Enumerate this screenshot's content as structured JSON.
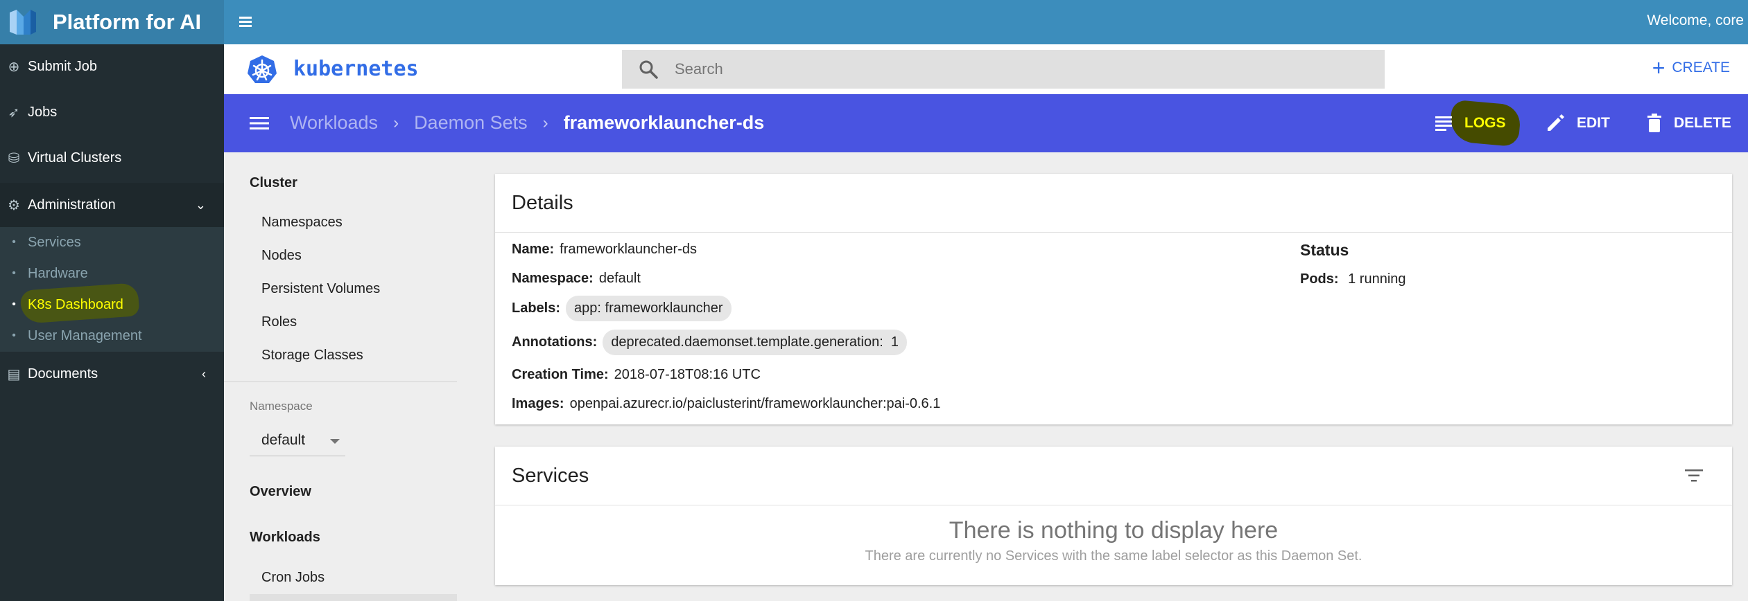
{
  "pai": {
    "brand": "Platform for AI",
    "welcome": "Welcome, core",
    "sidebar": {
      "items": [
        {
          "label": "Submit Job",
          "icon": "plus-circle-icon"
        },
        {
          "label": "Jobs",
          "icon": "rocket-icon"
        },
        {
          "label": "Virtual Clusters",
          "icon": "cubes-icon"
        },
        {
          "label": "Administration",
          "icon": "gears-icon"
        },
        {
          "label": "Documents",
          "icon": "book-icon"
        }
      ],
      "admin_sub": [
        {
          "label": "Services"
        },
        {
          "label": "Hardware"
        },
        {
          "label": "K8s Dashboard"
        },
        {
          "label": "User Management"
        }
      ]
    }
  },
  "k8s": {
    "wordmark": "kubernetes",
    "search_placeholder": "Search",
    "create_label": "CREATE",
    "breadcrumb": [
      "Workloads",
      "Daemon Sets",
      "frameworklauncher-ds"
    ],
    "actions": {
      "logs": "LOGS",
      "edit": "EDIT",
      "delete": "DELETE"
    },
    "nav": {
      "cluster_heading": "Cluster",
      "cluster_items": [
        "Namespaces",
        "Nodes",
        "Persistent Volumes",
        "Roles",
        "Storage Classes"
      ],
      "namespace_label": "Namespace",
      "namespace_value": "default",
      "overview": "Overview",
      "workloads_heading": "Workloads",
      "workloads_items": [
        "Cron Jobs"
      ]
    },
    "details": {
      "title": "Details",
      "name_key": "Name:",
      "name_value": "frameworklauncher-ds",
      "namespace_key": "Namespace:",
      "namespace_value": "default",
      "labels_key": "Labels:",
      "labels_value": "app: frameworklauncher",
      "annotations_key": "Annotations:",
      "annotations_value": "deprecated.daemonset.template.generation:  1",
      "creation_key": "Creation Time:",
      "creation_value": "2018-07-18T08:16 UTC",
      "images_key": "Images:",
      "images_value": "openpai.azurecr.io/paiclusterint/frameworklauncher:pai-0.6.1",
      "status_title": "Status",
      "pods_key": "Pods:",
      "pods_value": "1 running"
    },
    "services": {
      "title": "Services",
      "empty_title": "There is nothing to display here",
      "empty_sub": "There are currently no Services with the same label selector as this Daemon Set."
    }
  },
  "colors": {
    "pai_header": "#3c8dbc",
    "pai_sidebar": "#222d32",
    "k8s_blue": "#326de6",
    "toolbar": "#4954e1",
    "highlight": "#ffff00"
  }
}
